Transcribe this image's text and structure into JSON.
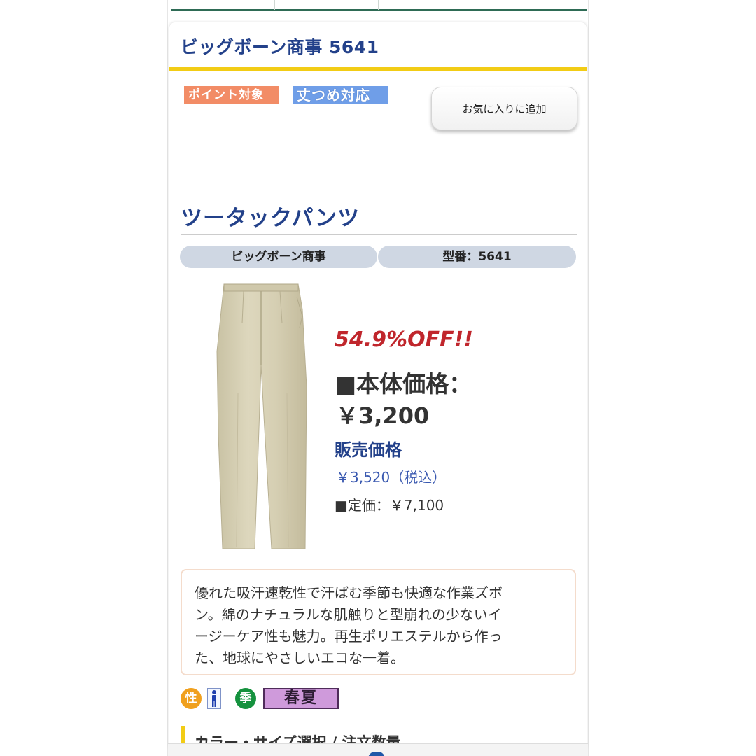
{
  "header": {
    "shop_title": "ビッグボーン商事 5641"
  },
  "badges": {
    "point": "ポイント対象",
    "size": "丈つめ対応"
  },
  "favorite_button": "お気に入りに追加",
  "product": {
    "title": "ツータックパンツ",
    "maker": "ビッグボーン商事",
    "model": "型番：5641"
  },
  "pricing": {
    "discount": "54.9%OFF!!",
    "body_price_label": "■本体価格：",
    "body_price": "￥3,200",
    "sale_label": "販売価格",
    "sale_price": "￥3,520（税込）",
    "list_price": "■定価：￥7,100"
  },
  "description": {
    "lines": [
      "優れた吸汗速乾性で汗ばむ季節も快適な作業ズボ",
      "ン。綿のナチュラルな肌触りと型崩れの少ないイ",
      "ージーケア性も魅力。再生ポリエステルから作っ",
      "た、地球にやさしいエコな一着。"
    ]
  },
  "attributes": {
    "sex_icon": "性",
    "season_icon": "季",
    "season_value": "春夏"
  },
  "order_section": {
    "title": "カラー・サイズ選択 / 注文数量"
  },
  "icons": {
    "man": "man-icon"
  },
  "colors": {
    "title_blue": "#23418a",
    "accent_yellow": "#f2cc15",
    "discount_red": "#c0262c",
    "pants_khaki": "#d9d3b8"
  }
}
